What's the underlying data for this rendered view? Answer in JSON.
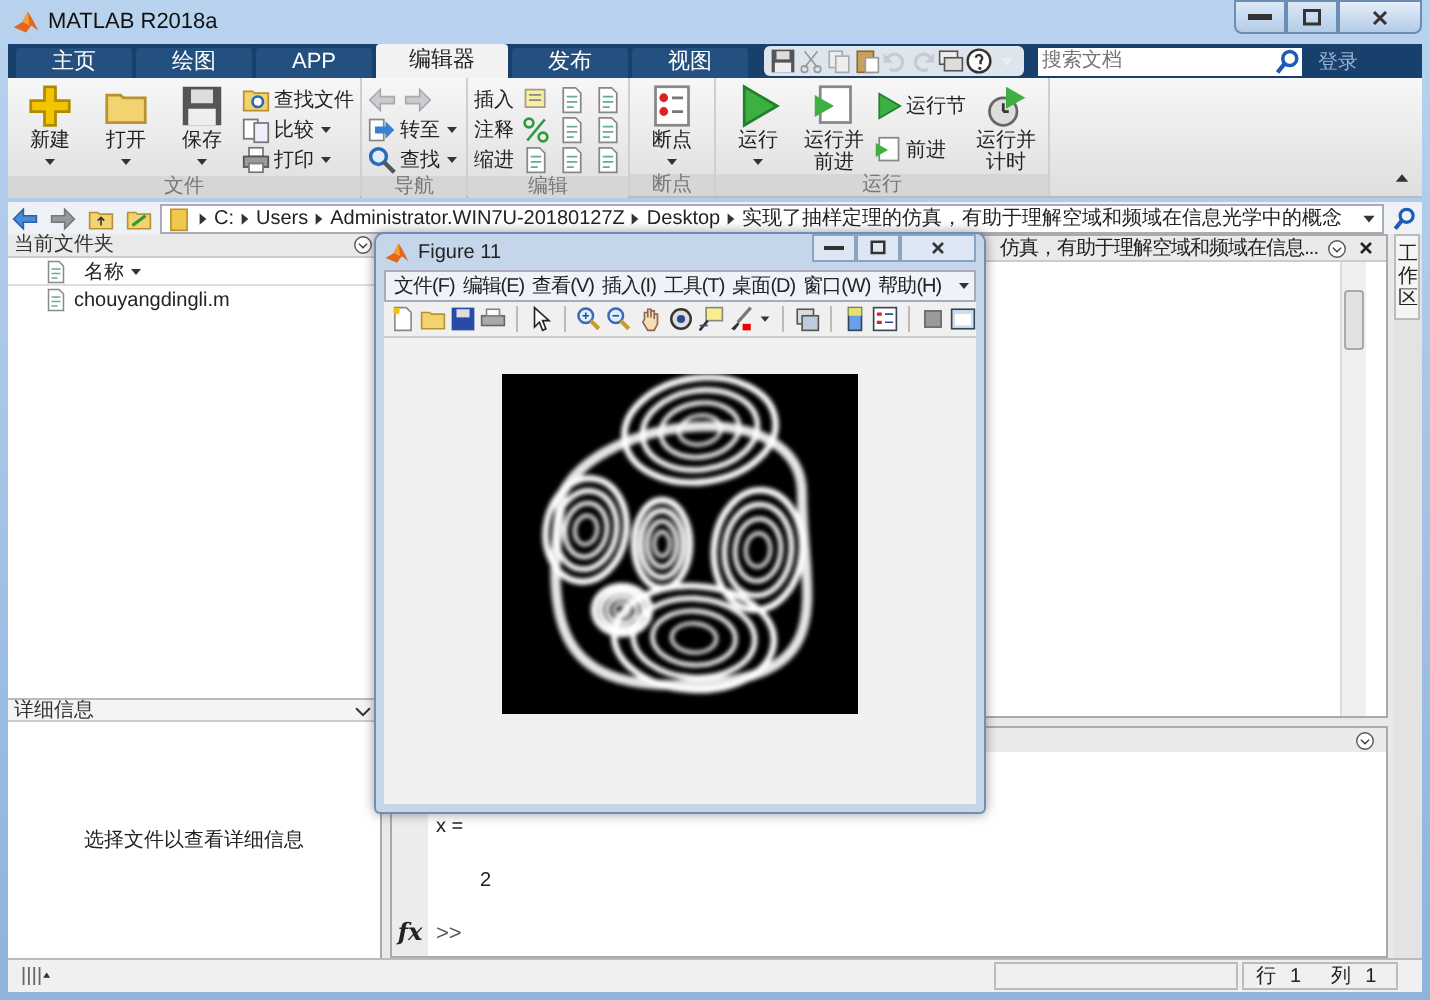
{
  "window": {
    "title": "MATLAB R2018a"
  },
  "tabs": [
    {
      "label": "主页",
      "selected": false
    },
    {
      "label": "绘图",
      "selected": false
    },
    {
      "label": "APP",
      "selected": false
    },
    {
      "label": "编辑器",
      "selected": true
    },
    {
      "label": "发布",
      "selected": false
    },
    {
      "label": "视图",
      "selected": false
    }
  ],
  "search": {
    "placeholder": "搜索文档"
  },
  "sign_in": "登录",
  "ribbon": {
    "groups": [
      {
        "title": "文件",
        "items": [
          {
            "kind": "large",
            "label": "新建",
            "menu": true
          },
          {
            "kind": "large",
            "label": "打开",
            "menu": true
          },
          {
            "kind": "large",
            "label": "保存",
            "menu": true
          },
          {
            "kind": "small",
            "label": "查找文件",
            "menu": false
          },
          {
            "kind": "small",
            "label": "比较",
            "menu": true
          },
          {
            "kind": "small",
            "label": "打印",
            "menu": true
          }
        ]
      },
      {
        "title": "导航",
        "items": [
          {
            "kind": "icons"
          },
          {
            "kind": "small",
            "label": "转至",
            "menu": true
          },
          {
            "kind": "small",
            "label": "查找",
            "menu": true
          }
        ]
      },
      {
        "title": "编辑",
        "items": [
          {
            "kind": "small",
            "label": "插入",
            "menu": false
          },
          {
            "kind": "small",
            "label": "注释",
            "menu": false
          },
          {
            "kind": "small",
            "label": "缩进",
            "menu": false
          }
        ]
      },
      {
        "title": "断点",
        "items": [
          {
            "kind": "large",
            "label": "断点",
            "menu": true
          }
        ]
      },
      {
        "title": "运行",
        "items": [
          {
            "kind": "large",
            "label": "运行",
            "menu": true
          },
          {
            "kind": "large",
            "label": "运行并前进",
            "menu": false
          },
          {
            "kind": "small",
            "label": "运行节",
            "menu": false
          },
          {
            "kind": "small",
            "label": "前进",
            "menu": false
          },
          {
            "kind": "large",
            "label": "运行并计时",
            "menu": false
          }
        ]
      }
    ]
  },
  "address": {
    "crumbs": [
      "C:",
      "Users",
      "Administrator.WIN7U-20180127Z",
      "Desktop",
      "实现了抽样定理的仿真，有助于理解空域和频域在信息光学中的概念"
    ]
  },
  "current_folder": {
    "title": "当前文件夹",
    "column": "名称",
    "files": [
      {
        "name": "chouyangdingli.m"
      }
    ]
  },
  "details": {
    "title": "详细信息",
    "message": "选择文件以查看详细信息"
  },
  "editor": {
    "tab_title": "仿真，有助于理解空域和频域在信息..."
  },
  "command_window": {
    "lines": [
      "x =",
      "2"
    ],
    "function_button": "fx",
    "prompt": ">>"
  },
  "workspace_tab": "工作区",
  "status": [
    {
      "label": "行",
      "value": "1"
    },
    {
      "label": "列",
      "value": "1"
    }
  ],
  "figure": {
    "title": "Figure 11",
    "menu": [
      "文件(F)",
      "编辑(E)",
      "查看(V)",
      "插入(I)",
      "工具(T)",
      "桌面(D)",
      "窗口(W)",
      "帮助(H)"
    ]
  }
}
